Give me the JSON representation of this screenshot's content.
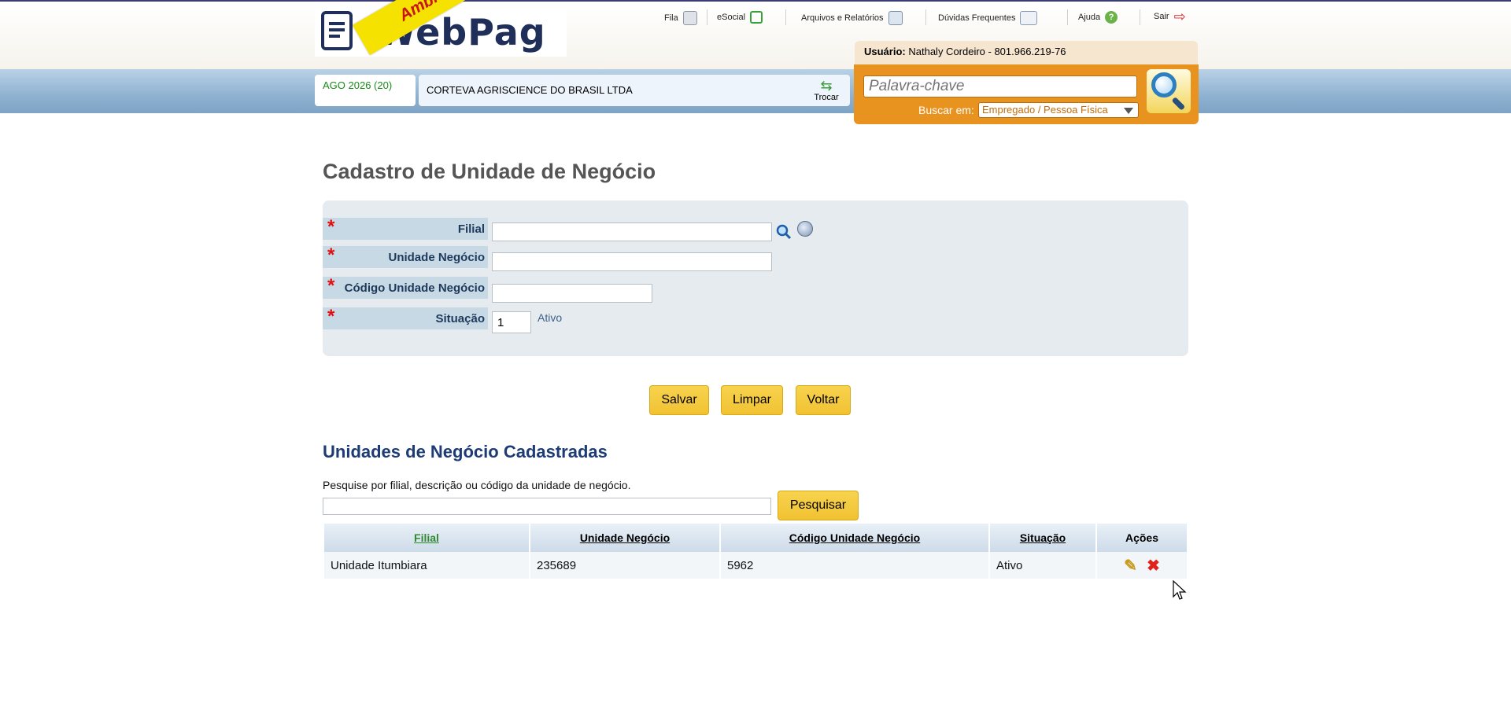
{
  "header": {
    "logo_text": "WebPag",
    "ribbon": "Ambiente Teste",
    "nav": [
      {
        "label": "Fila",
        "icon": "calculator-icon"
      },
      {
        "label": "eSocial",
        "icon": "esocial-icon"
      },
      {
        "label": "Arquivos e Relatórios",
        "icon": "reports-icon"
      },
      {
        "label": "Dúvidas Frequentes",
        "icon": "faq-icon"
      },
      {
        "label": "Ajuda",
        "icon": "help-icon"
      },
      {
        "label": "Sair",
        "icon": "exit-icon"
      }
    ],
    "user_label": "Usuário:",
    "user_value": "Nathaly Cordeiro - 801.966.219-76",
    "search": {
      "placeholder": "Palavra-chave",
      "scope_label": "Buscar em:",
      "scope_value": "Empregado / Pessoa Física"
    },
    "period": "AGO 2026 (20)",
    "company": "CORTEVA AGRISCIENCE DO BRASIL LTDA",
    "trocar_label": "Trocar"
  },
  "form": {
    "title": "Cadastro de Unidade de Negócio",
    "fields": {
      "filial": {
        "label": "Filial",
        "value": ""
      },
      "unidade": {
        "label": "Unidade Negócio",
        "value": ""
      },
      "codigo": {
        "label": "Código Unidade Negócio",
        "value": ""
      },
      "situacao": {
        "label": "Situação",
        "value": "1",
        "text": "Ativo"
      }
    },
    "required_mark": "*",
    "buttons": {
      "save": "Salvar",
      "clear": "Limpar",
      "back": "Voltar"
    }
  },
  "list": {
    "title": "Unidades de Negócio Cadastradas",
    "hint": "Pesquise por filial, descrição ou código da unidade de negócio.",
    "search_button": "Pesquisar",
    "columns": [
      "Filial",
      "Unidade Negócio",
      "Código Unidade Negócio",
      "Situação",
      "Ações"
    ],
    "rows": [
      {
        "filial": "Unidade Itumbiara",
        "unidade": "235689",
        "codigo": "5962",
        "situacao": "Ativo"
      }
    ]
  },
  "colors": {
    "accent": "#f1c232",
    "search_panel": "#e8921f",
    "title_blue": "#1d3b75",
    "required": "#e01010"
  }
}
